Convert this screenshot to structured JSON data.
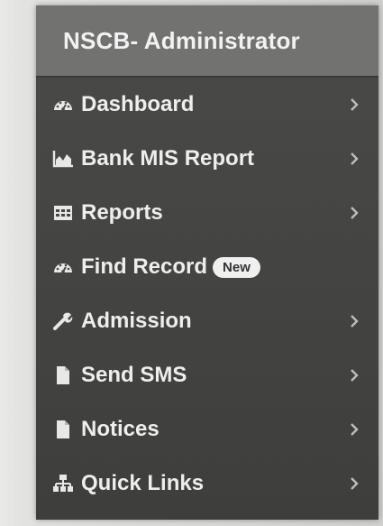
{
  "sidebar": {
    "title": "NSCB- Administrator",
    "items": [
      {
        "label": "Dashboard",
        "icon": "dashboard-icon",
        "has_chevron": true
      },
      {
        "label": "Bank MIS Report",
        "icon": "area-chart-icon",
        "has_chevron": true
      },
      {
        "label": "Reports",
        "icon": "table-icon",
        "has_chevron": true
      },
      {
        "label": "Find Record",
        "icon": "dashboard-icon",
        "badge": "New",
        "has_chevron": false
      },
      {
        "label": "Admission",
        "icon": "wrench-icon",
        "has_chevron": true
      },
      {
        "label": "Send SMS",
        "icon": "file-icon",
        "has_chevron": true
      },
      {
        "label": "Notices",
        "icon": "file-icon",
        "has_chevron": true
      },
      {
        "label": "Quick Links",
        "icon": "sitemap-icon",
        "has_chevron": true
      }
    ]
  },
  "colors": {
    "sidebar_bg": "#474745",
    "header_bg": "#727270",
    "text": "#eeeeee",
    "badge_bg": "#f0f0f0"
  }
}
